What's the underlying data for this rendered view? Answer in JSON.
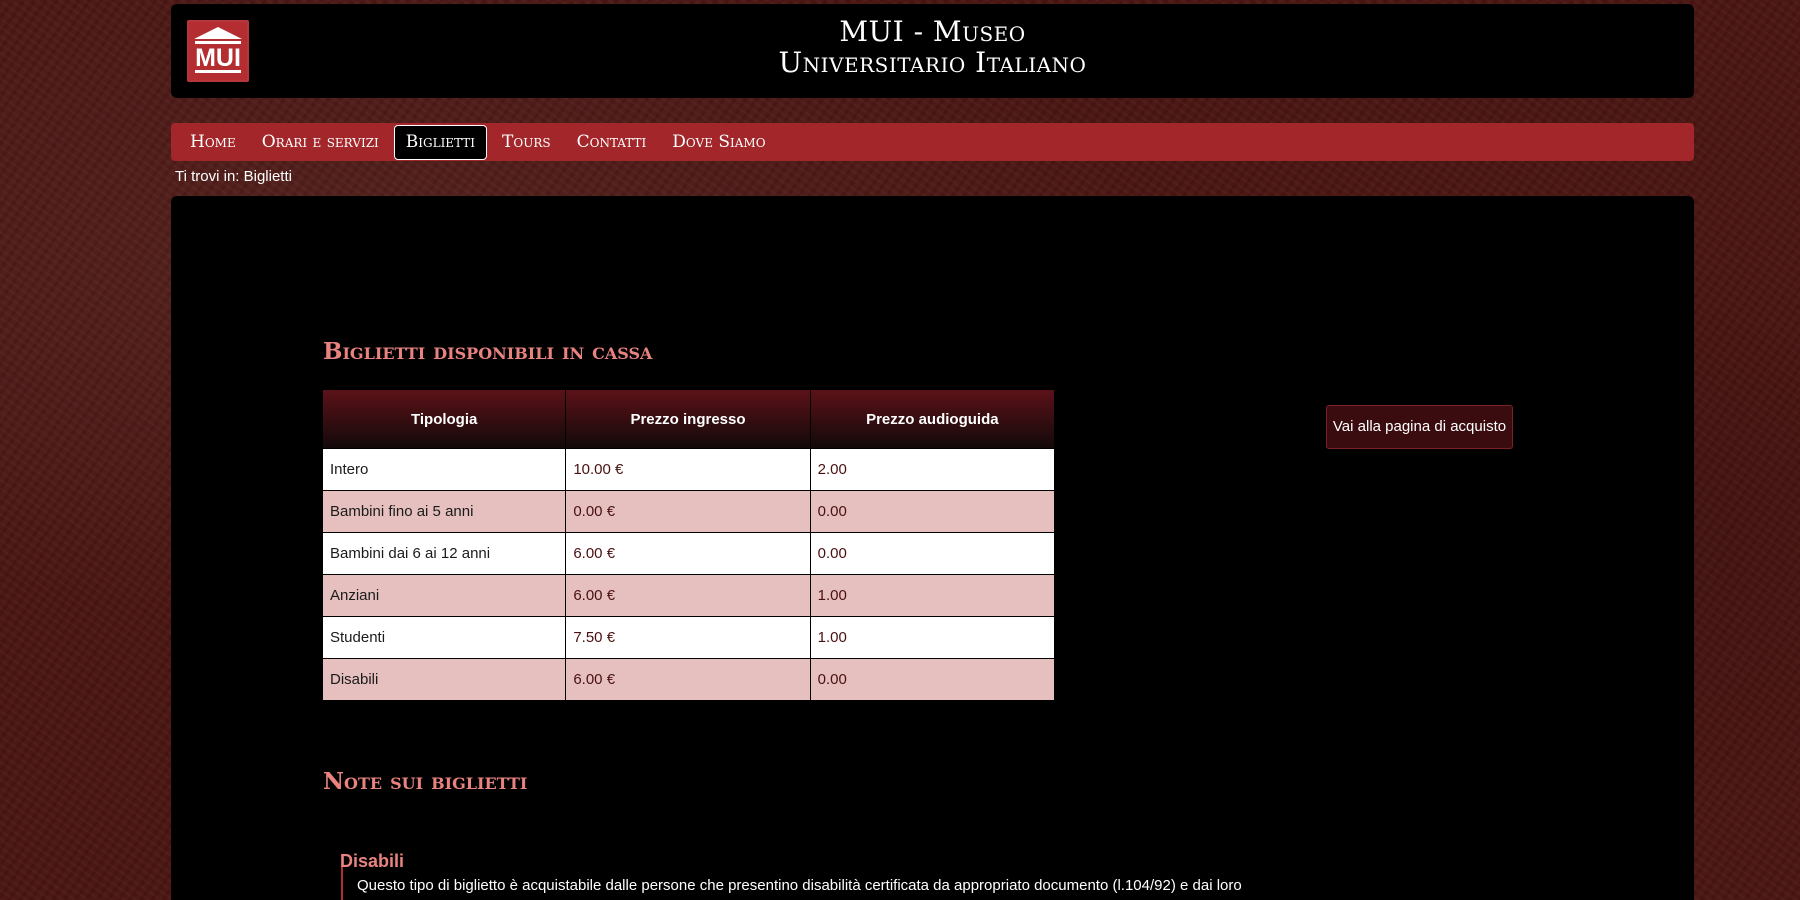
{
  "header": {
    "logo_text": "MUI",
    "title_line1": "MUI - Museo",
    "title_line2": "Universitario Italiano"
  },
  "nav": {
    "items": [
      {
        "label": "Home",
        "active": false
      },
      {
        "label": "Orari e servizi",
        "active": false
      },
      {
        "label": "Biglietti",
        "active": true
      },
      {
        "label": "Tours",
        "active": false
      },
      {
        "label": "Contatti",
        "active": false
      },
      {
        "label": "Dove Siamo",
        "active": false
      }
    ]
  },
  "breadcrumb": {
    "text": "Ti trovi in: Biglietti"
  },
  "tickets_section": {
    "title": "Biglietti disponibili in cassa",
    "table": {
      "headers": [
        "Tipologia",
        "Prezzo ingresso",
        "Prezzo audioguida"
      ],
      "rows": [
        [
          "Intero",
          "10.00 €",
          "2.00"
        ],
        [
          "Bambini fino ai 5 anni",
          "0.00 €",
          "0.00"
        ],
        [
          "Bambini dai 6 ai 12 anni",
          "6.00 €",
          "0.00"
        ],
        [
          "Anziani",
          "6.00 €",
          "1.00"
        ],
        [
          "Studenti",
          "7.50 €",
          "1.00"
        ],
        [
          "Disabili",
          "6.00 €",
          "0.00"
        ]
      ]
    },
    "buy_button": "Vai alla pagina di acquisto"
  },
  "notes_section": {
    "title": "Note sui biglietti",
    "subtitle": "Disabili",
    "text": "Questo tipo di biglietto è acquistabile dalle persone che presentino disabilità certificata da appropriato documento (l.104/92) e dai loro"
  },
  "colors": {
    "background": "#4a1512",
    "nav": "#a3262a",
    "accent": "#e9837f",
    "table_even_row": "#e5c0bf",
    "logo": "#b32d31"
  },
  "icons": {
    "logo": "museum-temple-icon"
  }
}
